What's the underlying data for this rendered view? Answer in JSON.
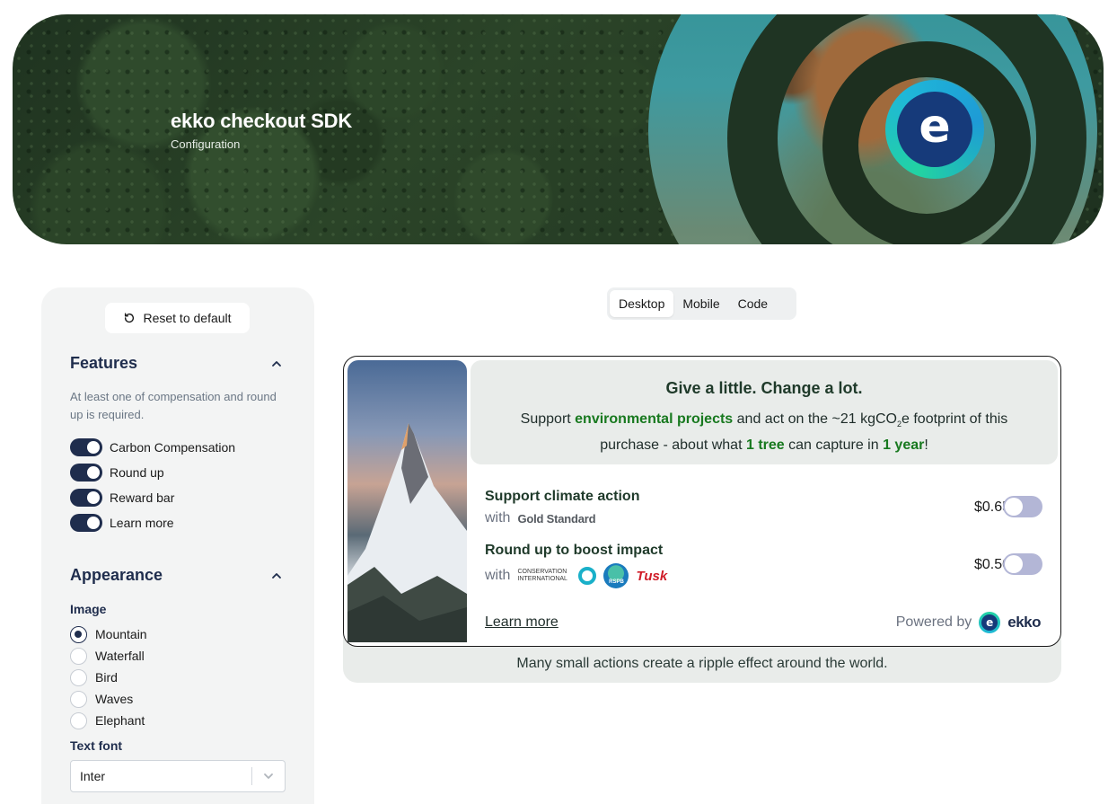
{
  "hero": {
    "title": "ekko checkout SDK",
    "subtitle": "Configuration",
    "badge_letter": "e"
  },
  "sidebar": {
    "reset_label": "Reset to default",
    "features": {
      "title": "Features",
      "hint": "At least one of compensation and round up is required.",
      "toggles": [
        {
          "label": "Carbon Compensation",
          "on": true
        },
        {
          "label": "Round up",
          "on": true
        },
        {
          "label": "Reward bar",
          "on": true
        },
        {
          "label": "Learn more",
          "on": true
        }
      ]
    },
    "appearance": {
      "title": "Appearance",
      "image_label": "Image",
      "image_options": [
        {
          "label": "Mountain",
          "checked": true
        },
        {
          "label": "Waterfall",
          "checked": false
        },
        {
          "label": "Bird",
          "checked": false
        },
        {
          "label": "Waves",
          "checked": false
        },
        {
          "label": "Elephant",
          "checked": false
        }
      ],
      "font_label": "Text font",
      "font_value": "Inter"
    }
  },
  "tabs": [
    {
      "label": "Desktop",
      "active": true
    },
    {
      "label": "Mobile",
      "active": false
    },
    {
      "label": "Code",
      "active": false
    }
  ],
  "widget": {
    "headline": "Give a little. Change a lot.",
    "support_prefix": "Support ",
    "support_link": "environmental projects",
    "support_mid": " and act on the ~21 kgCO",
    "support_sub": "2",
    "support_after": "e footprint of this purchase - about what ",
    "tree_count": "1 tree",
    "support_capture": " can capture in ",
    "year": "1 year",
    "support_end": "!",
    "offers": [
      {
        "title": "Support climate action",
        "with": "with",
        "price": "$0.65",
        "enabled": false
      },
      {
        "title": "Round up to boost impact",
        "with": "with",
        "price": "$0.50",
        "enabled": false
      }
    ],
    "partners": {
      "gold_standard": "Gold Standard",
      "conservation": "Conservation International",
      "rspb": "RSPB",
      "tusk": "Tusk"
    },
    "learn_more": "Learn more",
    "powered_by": "Powered by",
    "brand": "ekko",
    "footer": "Many small actions create a ripple effect around the world."
  },
  "colors": {
    "navy": "#1f2d4d",
    "green": "#18791f",
    "toggle_off": "#b3b6d6",
    "panel_bg": "#f3f4f4"
  }
}
